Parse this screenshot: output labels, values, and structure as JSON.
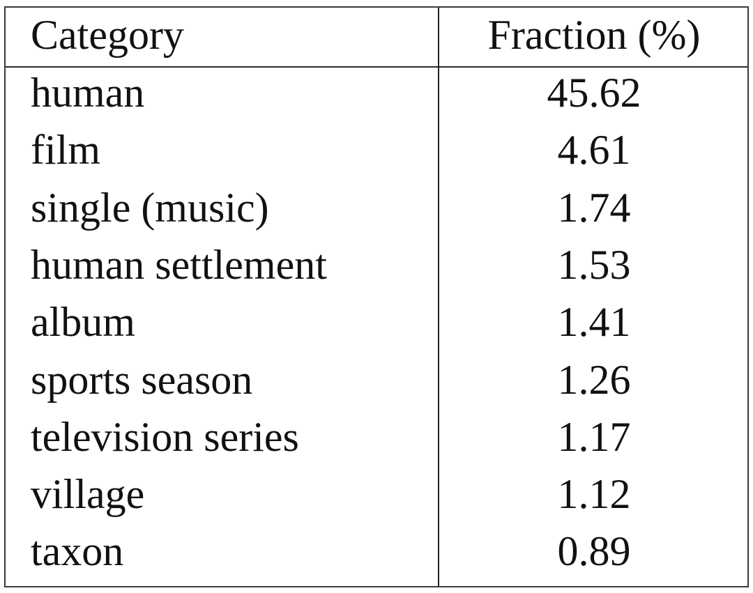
{
  "table": {
    "headers": {
      "category": "Category",
      "fraction": "Fraction (%)"
    },
    "rows": [
      {
        "category": "human",
        "fraction": "45.62"
      },
      {
        "category": "film",
        "fraction": "4.61"
      },
      {
        "category": "single (music)",
        "fraction": "1.74"
      },
      {
        "category": "human settlement",
        "fraction": "1.53"
      },
      {
        "category": "album",
        "fraction": "1.41"
      },
      {
        "category": "sports season",
        "fraction": "1.26"
      },
      {
        "category": "television series",
        "fraction": "1.17"
      },
      {
        "category": "village",
        "fraction": "1.12"
      },
      {
        "category": "taxon",
        "fraction": "0.89"
      }
    ]
  }
}
